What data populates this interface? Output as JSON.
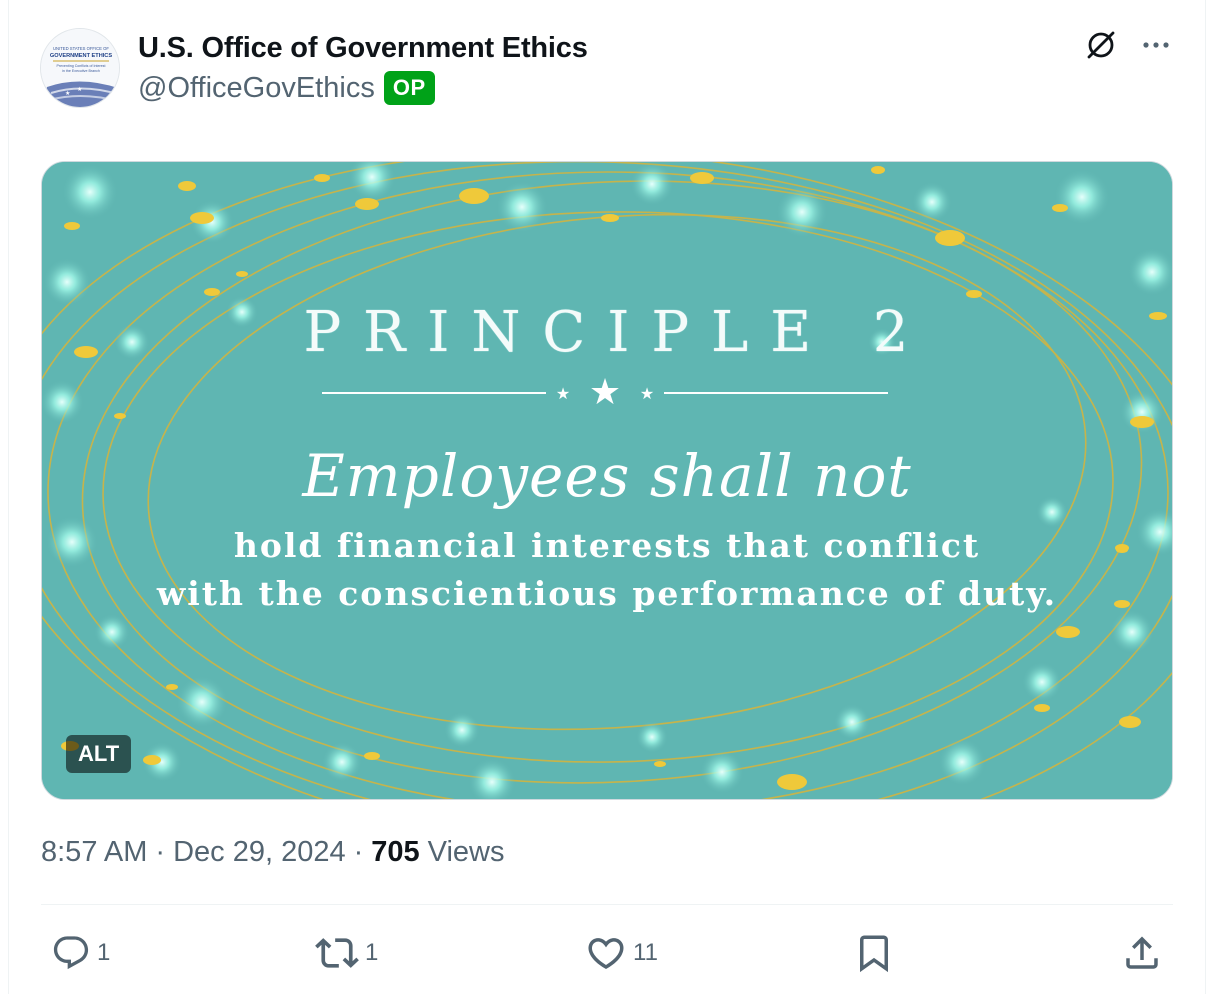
{
  "tweet": {
    "author": {
      "display_name": "U.S. Office of Government Ethics",
      "handle": "@OfficeGovEthics",
      "badge": "OP",
      "avatar_lines": [
        "UNITED STATES OFFICE OF",
        "GOVERNMENT ETHICS",
        "Preventing Conflicts of Interest",
        "in the Executive Branch"
      ]
    },
    "media": {
      "heading": "PRINCIPLE 2",
      "script_line": "Employees shall not",
      "body_line_1": "hold financial interests that conflict",
      "body_line_2": "with the conscientious performance of duty.",
      "alt_label": "ALT",
      "background_color": "#5fb6b2",
      "accent_gold": "#e8c53a"
    },
    "meta": {
      "time": "8:57 AM",
      "separator": "·",
      "date": "Dec 29, 2024",
      "views_count": "705",
      "views_label": "Views"
    },
    "actions": {
      "replies": "1",
      "reposts": "1",
      "likes": "11"
    }
  },
  "icons": {
    "grok": "grok-icon",
    "more": "more-icon",
    "reply": "reply-icon",
    "repost": "repost-icon",
    "like": "like-icon",
    "bookmark": "bookmark-icon",
    "share": "share-icon"
  },
  "colors": {
    "op_badge": "#00a218",
    "secondary_text": "#536471",
    "primary_text": "#0f1419"
  }
}
